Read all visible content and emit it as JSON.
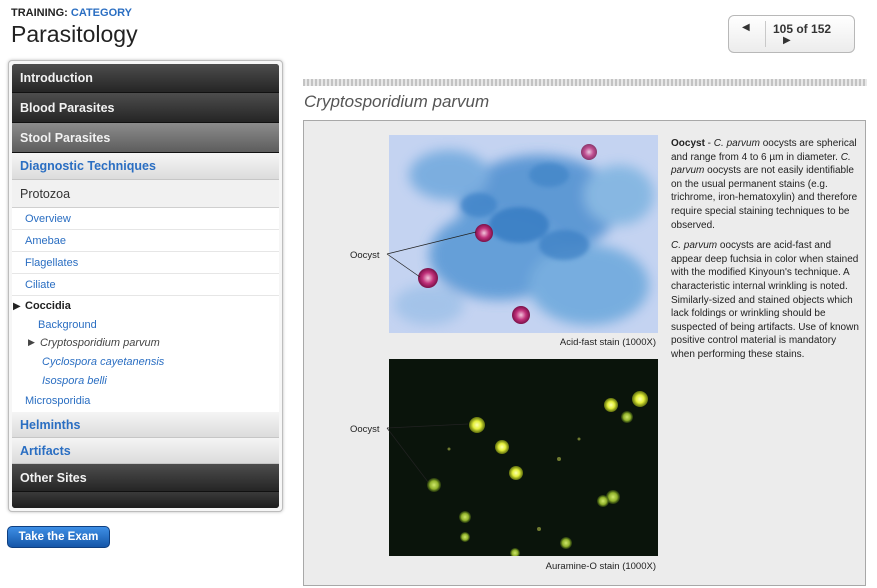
{
  "header": {
    "crumb_prefix": "TRAINING:",
    "crumb_link": "CATEGORY",
    "title": "Parasitology"
  },
  "pager": {
    "count": "105 of 152",
    "prev_icon": "arrow-left-icon",
    "next_icon": "arrow-right-icon"
  },
  "sidebar": {
    "introduction": "Introduction",
    "blood_parasites": "Blood Parasites",
    "stool_parasites": "Stool Parasites",
    "diagnostic_techniques": "Diagnostic Techniques",
    "protozoa": "Protozoa",
    "sub_items": [
      "Overview",
      "Amebae",
      "Flagellates",
      "Ciliate"
    ],
    "coccidia": "Coccidia",
    "coccidia_items": [
      "Background",
      "Cryptosporidium parvum",
      "Cyclospora cayetanensis",
      "Isospora belli"
    ],
    "microsporidia": "Microsporidia",
    "helminths": "Helminths",
    "artifacts": "Artifacts",
    "other_sites": "Other Sites"
  },
  "exam_button": "Take the Exam",
  "content": {
    "title": "Cryptosporidium parvum",
    "image1_caption": "Acid-fast stain (1000X)",
    "image2_caption": "Auramine-O stain (1000X)",
    "label1": "Oocyst",
    "label2": "Oocyst",
    "p1_head": "Oocyst",
    "p1_a": " - ",
    "p1_b": "C. parvum",
    "p1_c": " oocysts are spherical and range from 4 to 6 µm in diameter. ",
    "p1_d": "C. parvum",
    "p1_e": " oocysts are not easily identifiable on the usual permanent stains (e.g. trichrome, iron-hematoxylin) and therefore require special staining techniques to be observed.",
    "p2_a": "C. parvum",
    "p2_b": " oocysts are acid-fast and appear deep fuchsia in color when stained with the modified Kinyoun's technique. A characteristic internal wrinkling is noted. Similarly-sized and stained objects which lack foldings or wrinkling should be suspected of being artifacts. Use of known positive control material is mandatory when performing these stains."
  },
  "colors": {
    "link": "#2a6ec2",
    "nav_dark": "#2b2b2b",
    "button": "#1f6cc8",
    "fuchsia_oocyst": "#c0307a",
    "fluorescent_oocyst": "#d8e830"
  }
}
